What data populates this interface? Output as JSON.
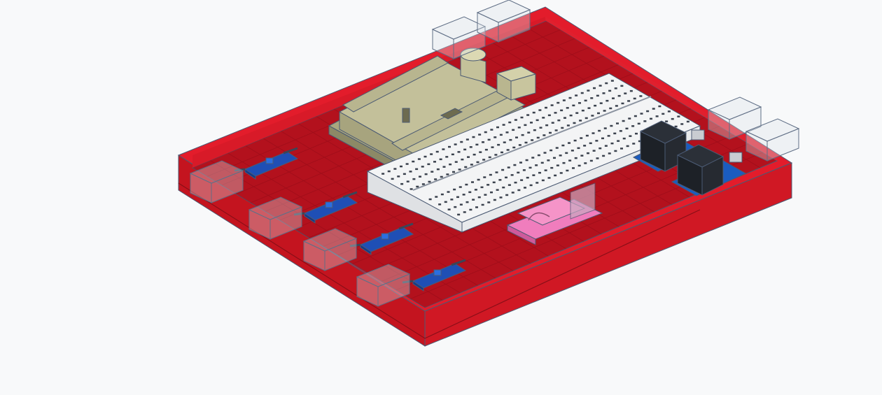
{
  "scene": {
    "background": "#f8f9fa",
    "colors": {
      "box_top": "#e31c2b",
      "box_wall_front": "#c4141f",
      "box_wall_side": "#d81a28",
      "box_floor": "#b5101c",
      "grid": "#8f0c18",
      "outline": "#4b5a73",
      "controller_board": "#b7b48f",
      "breadboard": "#f2f3f4",
      "sensor_module": "#1f4fb5",
      "relay_block": "#20242a",
      "relay_base": "#1a5cc0",
      "card_module": "#ec6fb3"
    },
    "objects": [
      {
        "name": "enclosure-base",
        "kind": "open box"
      },
      {
        "name": "controller-board",
        "kind": "microcontroller board"
      },
      {
        "name": "breadboard",
        "kind": "solderless breadboard"
      },
      {
        "name": "sensor-modules",
        "kind": "sensor module",
        "count": 4
      },
      {
        "name": "relay-modules",
        "kind": "relay",
        "count": 2
      },
      {
        "name": "card-reader-module",
        "kind": "card module"
      },
      {
        "name": "wall-cutouts",
        "kind": "transparent cutout boxes",
        "count": 8
      }
    ]
  }
}
